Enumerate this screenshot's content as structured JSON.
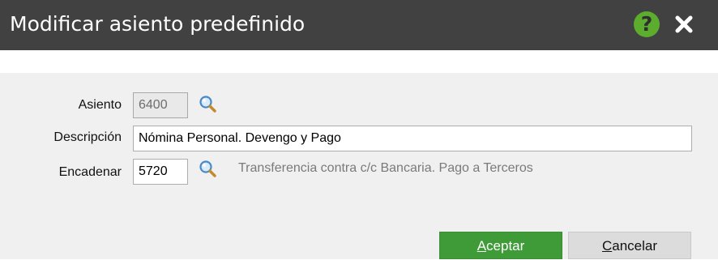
{
  "dialog": {
    "title": "Modificar asiento predefinido"
  },
  "titlebar_icons": {
    "help": "question-mark-icon",
    "help_glyph": "?",
    "close": "close-icon"
  },
  "form": {
    "asiento_label": "Asiento",
    "asiento_value": "6400",
    "descripcion_label": "Descripción",
    "descripcion_value": "Nómina Personal. Devengo y Pago",
    "encadenar_label": "Encadenar",
    "encadenar_value": "5720",
    "encadenar_hint": "Transferencia contra c/c Bancaria. Pago a Terceros"
  },
  "buttons": {
    "accept_label": "Aceptar",
    "cancel_label": "Cancelar"
  },
  "colors": {
    "titlebar": "#414141",
    "help_icon": "#5cac2e",
    "accept_button": "#3f9a38",
    "cancel_button": "#dcdcdc",
    "panel": "#f0f0f0"
  }
}
